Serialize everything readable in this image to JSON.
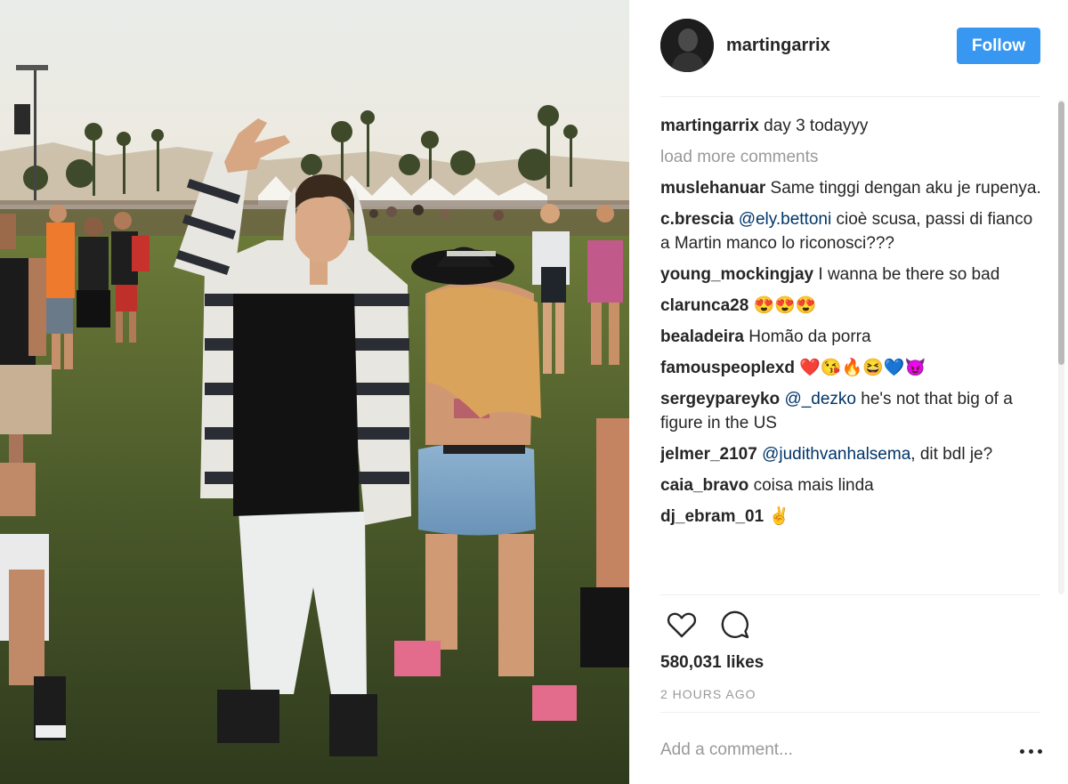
{
  "header": {
    "username": "martingarrix",
    "follow_label": "Follow"
  },
  "caption": {
    "user": "martingarrix",
    "text": "day 3 todayyy"
  },
  "load_more": "load more comments",
  "comments": [
    {
      "user": "muslehanuar",
      "mention": "",
      "text": "Same tinggi dengan aku je rupenya."
    },
    {
      "user": "c.brescia",
      "mention": "@ely.bettoni",
      "text": "cioè scusa, passi di fianco a Martin manco lo riconosci???"
    },
    {
      "user": "young_mockingjay",
      "mention": "",
      "text": "I wanna be there so bad"
    },
    {
      "user": "clarunca28",
      "mention": "",
      "text": "😍😍😍"
    },
    {
      "user": "bealadeira",
      "mention": "",
      "text": "Homão da porra"
    },
    {
      "user": "famouspeoplexd",
      "mention": "",
      "text": "❤️😘🔥😆💙😈"
    },
    {
      "user": "sergeypareyko",
      "mention": "@_dezko",
      "text": "he's not that big of a figure in the US"
    },
    {
      "user": "jelmer_2107",
      "mention": "@judithvanhalsema",
      "text": ", dit bdl je?"
    },
    {
      "user": "caia_bravo",
      "mention": "",
      "text": "coisa mais linda"
    },
    {
      "user": "dj_ebram_01",
      "mention": "",
      "text": "✌️"
    }
  ],
  "likes": "580,031 likes",
  "timestamp": "2 HOURS AGO",
  "add_comment_placeholder": "Add a comment...",
  "icons": {
    "like": "heart-icon",
    "comment": "comment-bubble-icon",
    "more": "more-options-icon"
  },
  "colors": {
    "follow": "#3897f0",
    "mention": "#003569",
    "muted": "#999999"
  }
}
